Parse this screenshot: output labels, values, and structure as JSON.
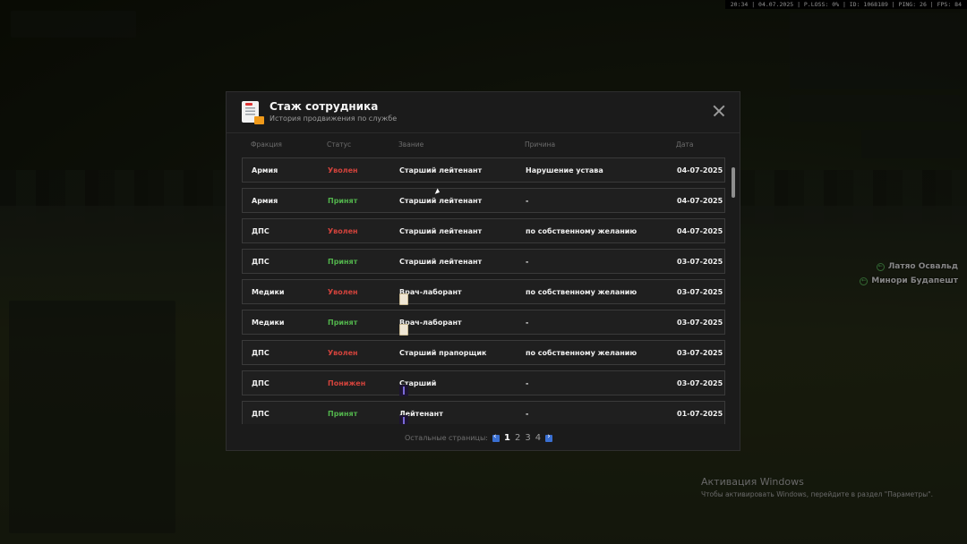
{
  "hud": {
    "stats": "20:34 | 04.07.2025 | P.LOSS: 0% | ID: 1068189 | PING: 26 | FPS: 84"
  },
  "players": [
    {
      "name": "Латяо Освальд"
    },
    {
      "name": "Минори Будапешт"
    }
  ],
  "windows_activation": {
    "title": "Активация Windows",
    "text": "Чтобы активировать Windows, перейдите в раздел \"Параметры\"."
  },
  "modal": {
    "title": "Стаж сотрудника",
    "subtitle": "История продвижения по службе",
    "columns": {
      "faction": "Фракция",
      "status": "Статус",
      "rank": "Звание",
      "reason": "Причина",
      "date": "Дата"
    },
    "rows": [
      {
        "faction": "Армия",
        "status": "Уволен",
        "status_color": "#d2433c",
        "rank": "Старший лейтенант",
        "rank_icon": "",
        "reason": "Нарушение устава",
        "date": "04-07-2025"
      },
      {
        "faction": "Армия",
        "status": "Принят",
        "status_color": "#52b34c",
        "rank": "Старший лейтенант",
        "rank_icon": "",
        "reason": "-",
        "date": "04-07-2025"
      },
      {
        "faction": "ДПС",
        "status": "Уволен",
        "status_color": "#d2433c",
        "rank": "Старший лейтенант",
        "rank_icon": "",
        "reason": "по собственному желанию",
        "date": "04-07-2025"
      },
      {
        "faction": "ДПС",
        "status": "Принят",
        "status_color": "#52b34c",
        "rank": "Старший лейтенант",
        "rank_icon": "",
        "reason": "-",
        "date": "03-07-2025"
      },
      {
        "faction": "Медики",
        "status": "Уволен",
        "status_color": "#d2433c",
        "rank": "Врач-лаборант",
        "rank_icon": "document-icon",
        "reason": "по собственному желанию",
        "date": "03-07-2025"
      },
      {
        "faction": "Медики",
        "status": "Принят",
        "status_color": "#52b34c",
        "rank": "Врач-лаборант",
        "rank_icon": "document-icon",
        "reason": "-",
        "date": "03-07-2025"
      },
      {
        "faction": "ДПС",
        "status": "Уволен",
        "status_color": "#d2433c",
        "rank": "Старший прапорщик",
        "rank_icon": "",
        "reason": "по собственному желанию",
        "date": "03-07-2025"
      },
      {
        "faction": "ДПС",
        "status": "Понижен",
        "status_color": "#d2433c",
        "rank": "Старший",
        "rank_icon": "rank-insignia-icon",
        "reason": "-",
        "date": "03-07-2025"
      },
      {
        "faction": "ДПС",
        "status": "Принят",
        "status_color": "#52b34c",
        "rank": "Лейтенант",
        "rank_icon": "rank-insignia-icon",
        "reason": "-",
        "date": "01-07-2025"
      }
    ],
    "pager": {
      "label": "Остальные страницы:",
      "pages": [
        "1",
        "2",
        "3",
        "4"
      ],
      "active": "1"
    }
  }
}
